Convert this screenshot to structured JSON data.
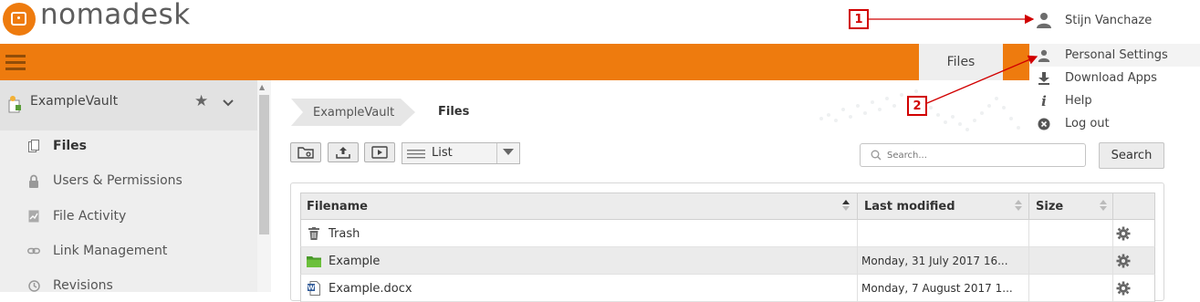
{
  "app": {
    "logo_text": "nomadesk"
  },
  "header": {
    "user_name": "Stijn Vanchaze"
  },
  "nav": {
    "files_tab": "Files"
  },
  "user_menu": {
    "items": [
      {
        "label": "Personal Settings",
        "icon": "person-icon"
      },
      {
        "label": "Download Apps",
        "icon": "download-icon"
      },
      {
        "label": "Help",
        "icon": "info-icon"
      },
      {
        "label": "Log out",
        "icon": "logout-icon"
      }
    ]
  },
  "callouts": [
    "1",
    "2"
  ],
  "sidebar": {
    "vault_name": "ExampleVault",
    "items": [
      {
        "label": "Files",
        "icon": "files-icon",
        "active": true
      },
      {
        "label": "Users & Permissions",
        "icon": "lock-icon"
      },
      {
        "label": "File Activity",
        "icon": "activity-icon"
      },
      {
        "label": "Link Management",
        "icon": "link-icon"
      },
      {
        "label": "Revisions",
        "icon": "history-icon"
      }
    ]
  },
  "breadcrumb": [
    "ExampleVault",
    "Files"
  ],
  "toolbar": {
    "view_mode": "List"
  },
  "search": {
    "placeholder": "Search...",
    "button_label": "Search"
  },
  "table": {
    "columns": [
      "Filename",
      "Last modified",
      "Size"
    ],
    "rows": [
      {
        "name": "Trash",
        "icon": "trash-icon",
        "modified": "",
        "size": ""
      },
      {
        "name": "Example",
        "icon": "folder-icon",
        "modified": "Monday, 31 July 2017 16...",
        "size": ""
      },
      {
        "name": "Example.docx",
        "icon": "word-doc-icon",
        "modified": "Monday, 7 August 2017 1...",
        "size": ""
      }
    ]
  },
  "colors": {
    "brand_orange": "#ee7b0e",
    "callout_red": "#d10000"
  }
}
